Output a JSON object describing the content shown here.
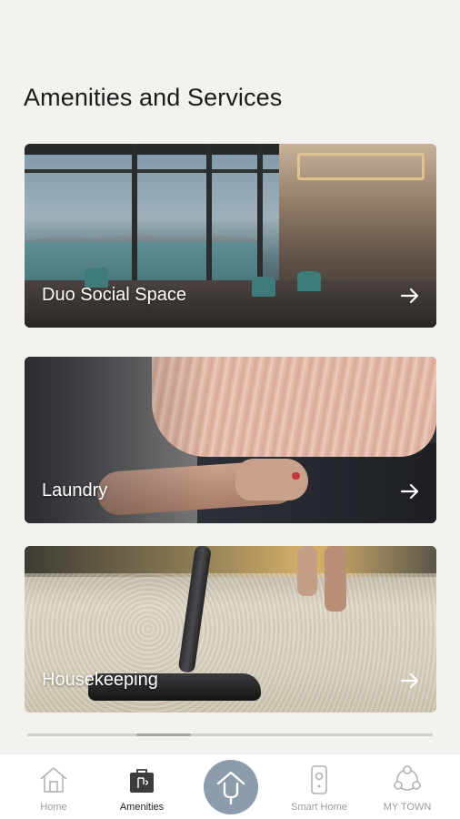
{
  "page": {
    "title": "Amenities and Services"
  },
  "cards": [
    {
      "label": "Duo Social Space",
      "icon": "arrow-right-icon"
    },
    {
      "label": "Laundry",
      "icon": "arrow-right-icon"
    },
    {
      "label": "Housekeeping",
      "icon": "arrow-right-icon"
    }
  ],
  "bottom_nav": {
    "items": [
      {
        "label": "Home",
        "icon": "home-icon",
        "active": false
      },
      {
        "label": "Amenities",
        "icon": "amenities-bag-icon",
        "active": true
      },
      {
        "label": "",
        "icon": "voice-home-icon",
        "active": false
      },
      {
        "label": "Smart Home",
        "icon": "smart-home-remote-icon",
        "active": false
      },
      {
        "label": "MY TOWN",
        "icon": "community-icon",
        "active": false
      }
    ],
    "center_color": "#8c9cab"
  },
  "colors": {
    "background": "#f3f2ef",
    "active_label": "#222222",
    "inactive_label": "#9a9a9a"
  }
}
